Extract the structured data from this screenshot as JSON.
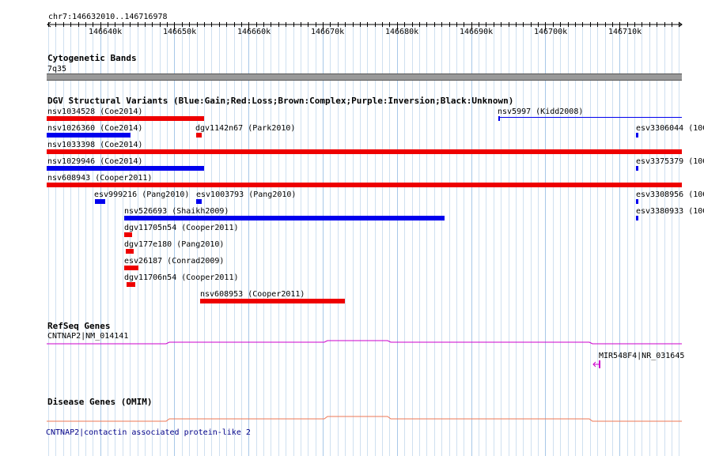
{
  "position_label": "chr7:146632010..146716978",
  "ruler": {
    "ticks": [
      "146640k",
      "146650k",
      "146660k",
      "146670k",
      "146680k",
      "146690k",
      "146700k",
      "146710k"
    ]
  },
  "cytobands": {
    "title": "Cytogenetic Bands",
    "band": "7q35"
  },
  "dgv": {
    "title": "DGV Structural Variants (Blue:Gain;Red:Loss;Brown:Complex;Purple:Inversion;Black:Unknown)",
    "legend": {
      "gain": "#0000ee",
      "loss": "#ee0000"
    },
    "features": [
      {
        "label": "nsv1034528 (Coe2014)",
        "type": "loss"
      },
      {
        "label": "nsv5997 (Kidd2008)",
        "type": "gain"
      },
      {
        "label": "nsv1026360 (Coe2014)",
        "type": "gain"
      },
      {
        "label": "dgv1142n67 (Park2010)",
        "type": "loss"
      },
      {
        "label": "esv3306044 (100",
        "type": "gain"
      },
      {
        "label": "nsv1033398 (Coe2014)",
        "type": "loss"
      },
      {
        "label": "nsv1029946 (Coe2014)",
        "type": "gain"
      },
      {
        "label": "esv3375379 (100",
        "type": "gain"
      },
      {
        "label": "nsv608943 (Cooper2011)",
        "type": "loss"
      },
      {
        "label": "esv999216 (Pang2010)",
        "type": "gain"
      },
      {
        "label": "esv1003793 (Pang2010)",
        "type": "gain"
      },
      {
        "label": "esv3308956 (100",
        "type": "gain"
      },
      {
        "label": "nsv526693 (Shaikh2009)",
        "type": "gain"
      },
      {
        "label": "esv3380933 (100",
        "type": "gain"
      },
      {
        "label": "dgv11705n54 (Cooper2011)",
        "type": "loss"
      },
      {
        "label": "dgv177e180 (Pang2010)",
        "type": "loss"
      },
      {
        "label": "esv26187 (Conrad2009)",
        "type": "loss"
      },
      {
        "label": "dgv11706n54 (Cooper2011)",
        "type": "loss"
      },
      {
        "label": "nsv608953 (Cooper2011)",
        "type": "loss"
      }
    ]
  },
  "refseq": {
    "title": "RefSeq Genes",
    "genes": [
      {
        "label": "CNTNAP2|NM_014141"
      },
      {
        "label": "MIR548F4|NR_031645"
      }
    ],
    "color": "#cc00cc"
  },
  "omim": {
    "title": "Disease Genes (OMIM)",
    "gene": "CNTNAP2|contactin associated protein-like 2",
    "label_color": "#000088",
    "line_color": "#ee7755"
  }
}
